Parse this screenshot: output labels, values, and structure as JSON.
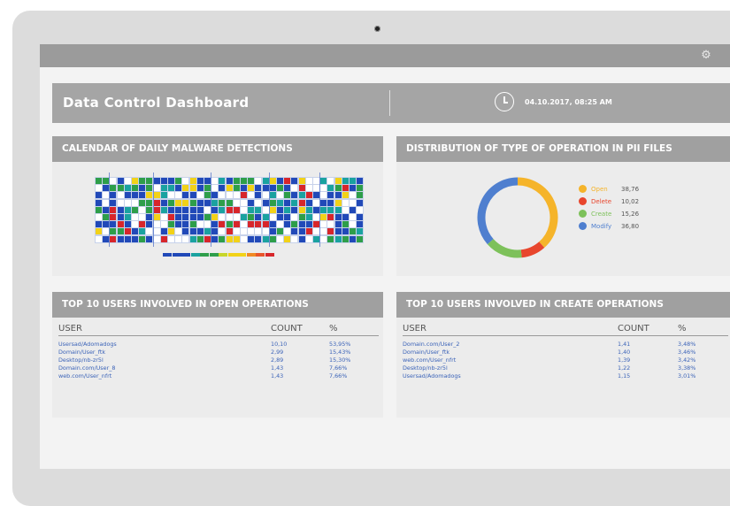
{
  "header": {
    "title": "Data Control Dashboard",
    "datetime": "04.10.2017, 08:25 AM"
  },
  "icons": {
    "settings": "gear-icon",
    "clock": "clock-icon"
  },
  "colors": {
    "open": "#f5b42a",
    "delete": "#e8462d",
    "create": "#7dc15a",
    "modify": "#4f7fcf",
    "grid_blue": "#2149b8",
    "grid_teal": "#1aa2a0",
    "grid_green": "#2e9e4a",
    "grid_yellow": "#f2d218",
    "grid_red": "#d7262b"
  },
  "panels": {
    "calendar": {
      "title": "CALENDAR OF DAILY MALWARE DETECTIONS"
    },
    "distribution": {
      "title": "DISTRIBUTION OF TYPE OF OPERATION IN PII FILES",
      "legend": [
        {
          "name": "Open",
          "value": "38,76"
        },
        {
          "name": "Delete",
          "value": "10,02"
        },
        {
          "name": "Create",
          "value": "15,26"
        },
        {
          "name": "Modify",
          "value": "36,80"
        }
      ]
    },
    "open_users": {
      "title": "TOP 10 USERS INVOLVED IN OPEN OPERATIONS",
      "columns": [
        "USER",
        "COUNT",
        "%"
      ],
      "rows": [
        [
          "Usersad/Adomadogs",
          "10,10",
          "53,95%"
        ],
        [
          "Domain/User_ftk",
          "2,99",
          "15,43%"
        ],
        [
          "Desktop/nb-zr5l",
          "2,89",
          "15,30%"
        ],
        [
          "Domain.com/User_8",
          "1,43",
          "7,66%"
        ],
        [
          "web.com/User_nfrt",
          "1,43",
          "7,66%"
        ]
      ]
    },
    "create_users": {
      "title": "TOP 10 USERS INVOLVED IN CREATE OPERATIONS",
      "columns": [
        "USER",
        "COUNT",
        "%"
      ],
      "rows": [
        [
          "Domain.com/User_2",
          "1,41",
          "3,48%"
        ],
        [
          "Domain/User_ftk",
          "1,40",
          "3,46%"
        ],
        [
          "web.com/User_nfrt",
          "1,39",
          "3,42%"
        ],
        [
          "Desktop/nb-zr5l",
          "1,22",
          "3,38%"
        ],
        [
          "Usersad/Adomadogs",
          "1,15",
          "3,01%"
        ]
      ]
    }
  },
  "chart_data": [
    {
      "type": "pie",
      "labels": [
        "Open",
        "Delete",
        "Create",
        "Modify"
      ],
      "values": [
        38.76,
        10.02,
        15.26,
        36.8
      ],
      "colors": [
        "#f5b42a",
        "#e8462d",
        "#7dc15a",
        "#4f7fcf"
      ]
    }
  ]
}
